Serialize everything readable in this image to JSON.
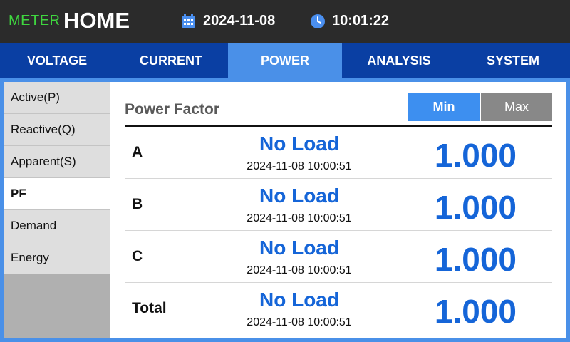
{
  "header": {
    "brand": "METER",
    "page": "HOME",
    "date": "2024-11-08",
    "time": "10:01:22",
    "calendar_icon": "calendar-icon",
    "clock_icon": "clock-icon"
  },
  "tabs": [
    {
      "label": "VOLTAGE",
      "active": false
    },
    {
      "label": "CURRENT",
      "active": false
    },
    {
      "label": "POWER",
      "active": true
    },
    {
      "label": "ANALYSIS",
      "active": false
    },
    {
      "label": "SYSTEM",
      "active": false
    }
  ],
  "sidebar": {
    "items": [
      {
        "label": "Active(P)",
        "active": false
      },
      {
        "label": "Reactive(Q)",
        "active": false
      },
      {
        "label": "Apparent(S)",
        "active": false
      },
      {
        "label": "PF",
        "active": true
      },
      {
        "label": "Demand",
        "active": false
      },
      {
        "label": "Energy",
        "active": false
      }
    ]
  },
  "main": {
    "title": "Power Factor",
    "min_label": "Min",
    "max_label": "Max",
    "rows": [
      {
        "phase": "A",
        "status": "No Load",
        "timestamp": "2024-11-08 10:00:51",
        "value": "1.000"
      },
      {
        "phase": "B",
        "status": "No Load",
        "timestamp": "2024-11-08 10:00:51",
        "value": "1.000"
      },
      {
        "phase": "C",
        "status": "No Load",
        "timestamp": "2024-11-08 10:00:51",
        "value": "1.000"
      },
      {
        "phase": "Total",
        "status": "No Load",
        "timestamp": "2024-11-08 10:00:51",
        "value": "1.000"
      }
    ]
  },
  "colors": {
    "header_bg": "#2b2b2b",
    "brand_green": "#3fd63f",
    "tab_bar": "#0a3fa3",
    "tab_active": "#4a90e8",
    "value_blue": "#1565d8",
    "min_button": "#3d8ff0",
    "max_button": "#888888"
  }
}
